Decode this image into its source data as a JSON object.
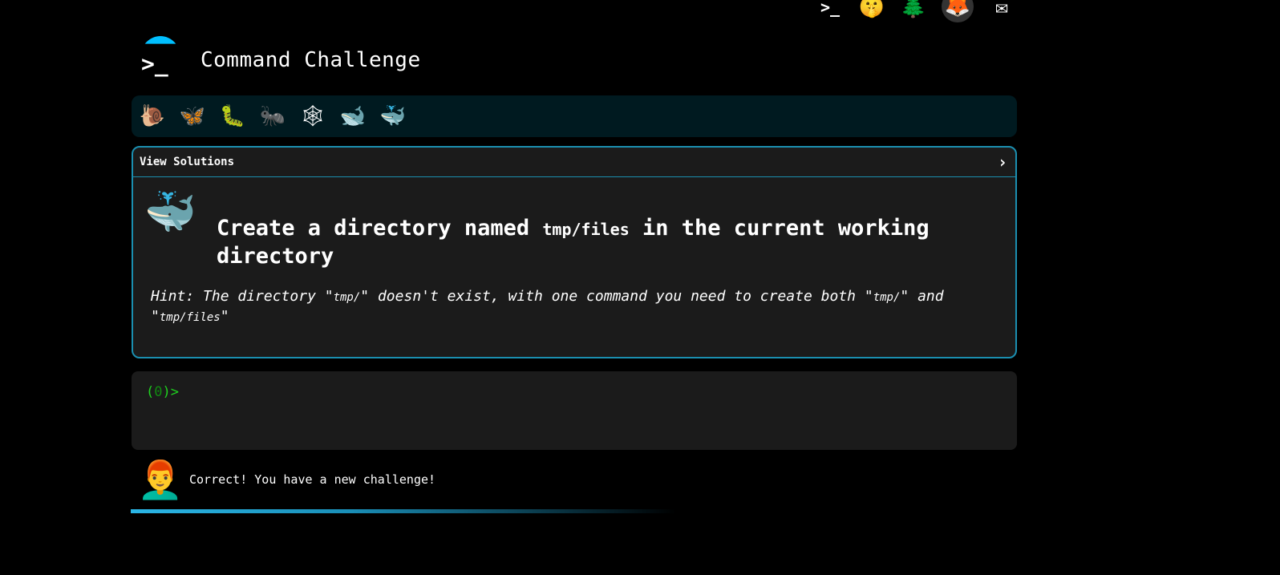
{
  "topbar": {
    "icons": [
      {
        "name": "terminal-icon",
        "glyph": ">_"
      },
      {
        "name": "shush-face-icon",
        "glyph": "🤫"
      },
      {
        "name": "tree-icon",
        "glyph": "🌲"
      },
      {
        "name": "gitlab-icon",
        "glyph": "🦊"
      },
      {
        "name": "mail-icon",
        "glyph": "✉"
      }
    ]
  },
  "header": {
    "title": "Command Challenge"
  },
  "levels": [
    {
      "name": "snail-level-icon",
      "glyph": "🐌"
    },
    {
      "name": "butterfly-level-icon",
      "glyph": "🦋"
    },
    {
      "name": "caterpillar-level-icon",
      "glyph": "🐛"
    },
    {
      "name": "ant-level-icon",
      "glyph": "🐜"
    },
    {
      "name": "spider-web-level-icon",
      "glyph": "🕸"
    },
    {
      "name": "whale-level-icon",
      "glyph": "🐋"
    },
    {
      "name": "spouting-whale-level-icon",
      "glyph": "🐳"
    }
  ],
  "panel": {
    "header_label": "View Solutions",
    "chevron": "›",
    "challenge_icon": "🐳",
    "title_before": "Create a directory named ",
    "title_code": "tmp/files",
    "title_after": " in the current working directory",
    "hint_prefix": "Hint: The directory \"",
    "hint_code1": "tmp/",
    "hint_mid": "\" doesn't exist, with one command you need to create both \"",
    "hint_code2": "tmp/",
    "hint_and": "\" and \"",
    "hint_code3": "tmp/files",
    "hint_end": "\""
  },
  "terminal": {
    "prompt_open": "(",
    "prompt_count": "0",
    "prompt_close": ")>"
  },
  "status": {
    "avatar": "👨‍🦰",
    "message": "Correct! You have a new challenge!"
  },
  "progress": {
    "fraction": 0.6
  }
}
